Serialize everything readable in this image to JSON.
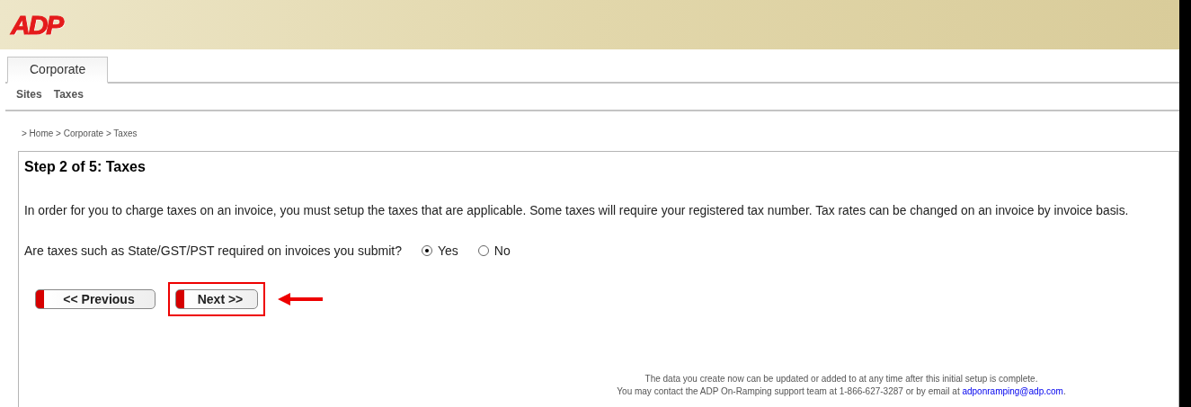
{
  "header": {
    "logo": "ADP"
  },
  "tabs": [
    {
      "label": "Corporate",
      "selected": true
    }
  ],
  "subnav": [
    {
      "label": "Sites"
    },
    {
      "label": "Taxes"
    }
  ],
  "breadcrumb": "> Home > Corporate > Taxes",
  "step": {
    "title": "Step 2 of 5: Taxes",
    "description": "In order for you to charge taxes on an invoice, you must setup the taxes that are applicable. Some taxes will require your registered tax number. Tax rates can be changed on an invoice by invoice basis.",
    "question": "Are taxes such as State/GST/PST required on invoices you submit?",
    "options": [
      {
        "label": "Yes",
        "selected": true
      },
      {
        "label": "No",
        "selected": false
      }
    ],
    "buttons": [
      {
        "label": "<< Previous",
        "highlighted": false
      },
      {
        "label": "Next >>",
        "highlighted": true
      }
    ]
  },
  "footer": {
    "line_1": "The data you create now can be updated or added to at any time after this initial setup is complete.",
    "line_2": "You may contact the ADP On-Ramping support team at 1-866-627-3287 or by email at ",
    "email": "adponramping@adp.com",
    "line_2_end": "."
  }
}
